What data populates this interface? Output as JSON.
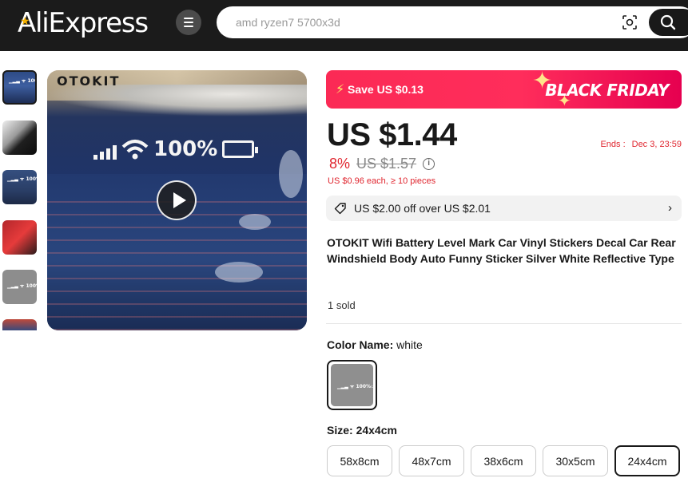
{
  "header": {
    "logo": "AliExpress",
    "search_placeholder": "amd ryzen7 5700x3d"
  },
  "gallery": {
    "brand_mark": "OTOKIT",
    "decal_text": "100%"
  },
  "promo": {
    "save_label": "Save US $0.13",
    "event_label": "BLACK FRIDAY"
  },
  "pricing": {
    "price": "US $1.44",
    "ends_label": "Ends :",
    "ends_date": "Dec 3, 23:59",
    "discount": "8%",
    "original_price": "US $1.57",
    "bulk_price": "US $0.96 each, ≥ 10 pieces"
  },
  "coupon": {
    "text": "US $2.00 off over US $2.01"
  },
  "product": {
    "title": "OTOKIT Wifi Battery Level Mark Car Vinyl Stickers Decal Car Rear Windshield Body Auto Funny Sticker Silver White Reflective Type",
    "sold": "1 sold"
  },
  "options": {
    "color_label": "Color Name:",
    "color_value": "white",
    "size_label": "Size:",
    "size_value": "24x4cm",
    "sizes": [
      "58x8cm",
      "48x7cm",
      "38x6cm",
      "30x5cm",
      "24x4cm"
    ]
  },
  "colors": {
    "header_bg": "#1b1b1b",
    "promo_red": "#ff2d5b",
    "price_red": "#e0262f"
  }
}
